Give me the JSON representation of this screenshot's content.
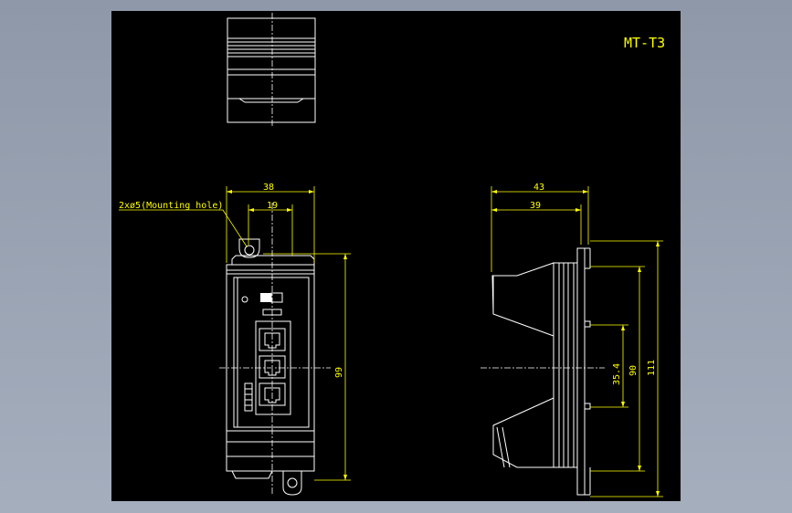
{
  "drawing": {
    "title": "MT-T3",
    "front_view": {
      "dim_width": "38",
      "dim_half_width": "19",
      "mounting_hole_note": "2xø5(Mounting hole)",
      "dim_body_height": "99"
    },
    "side_view": {
      "dim_depth_total": "43",
      "dim_depth_body": "39",
      "dim_rail": "35.4",
      "dim_height": "90",
      "dim_overall_height": "111"
    },
    "colors": {
      "background": "#000000",
      "outline": "#ffffff",
      "dimension": "#ffff00",
      "frame": "#9aa4b4"
    }
  }
}
